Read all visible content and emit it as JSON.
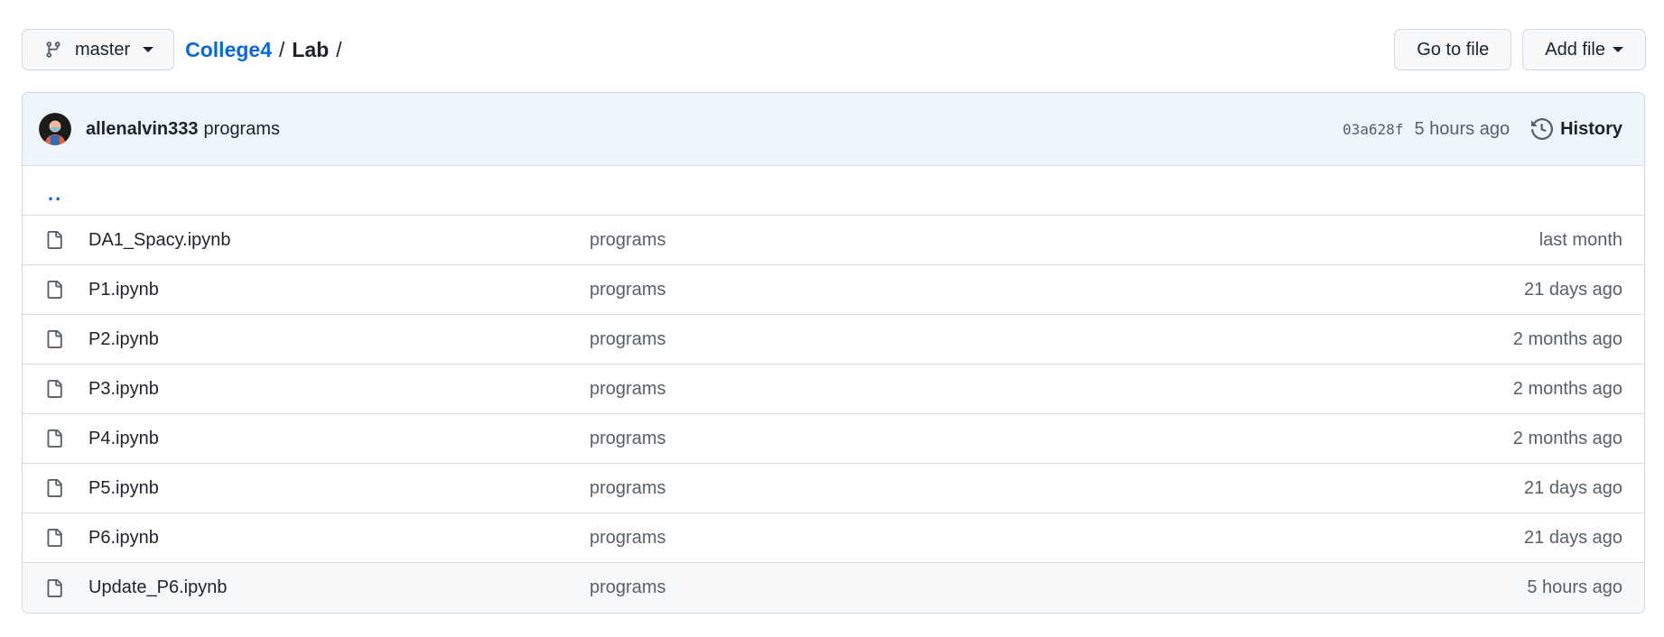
{
  "header": {
    "branch": "master",
    "breadcrumb": {
      "repo": "College4",
      "sep1": "/",
      "folder": "Lab",
      "sep2": "/"
    },
    "go_to_file": "Go to file",
    "add_file": "Add file"
  },
  "commit": {
    "author": "allenalvin333",
    "message": "programs",
    "sha": "03a628f",
    "time": "5 hours ago",
    "history": "History"
  },
  "parent_dir": "..",
  "files": [
    {
      "name": "DA1_Spacy.ipynb",
      "message": "programs",
      "time": "last month"
    },
    {
      "name": "P1.ipynb",
      "message": "programs",
      "time": "21 days ago"
    },
    {
      "name": "P2.ipynb",
      "message": "programs",
      "time": "2 months ago"
    },
    {
      "name": "P3.ipynb",
      "message": "programs",
      "time": "2 months ago"
    },
    {
      "name": "P4.ipynb",
      "message": "programs",
      "time": "2 months ago"
    },
    {
      "name": "P5.ipynb",
      "message": "programs",
      "time": "21 days ago"
    },
    {
      "name": "P6.ipynb",
      "message": "programs",
      "time": "21 days ago"
    },
    {
      "name": "Update_P6.ipynb",
      "message": "programs",
      "time": "5 hours ago"
    }
  ],
  "colors": {
    "link": "#0969da",
    "muted": "#57606a",
    "commit_bar_bg": "#eef5fd",
    "border": "#d0d7de"
  },
  "icons": {
    "branch": "git-branch-icon",
    "file": "file-icon",
    "history": "history-clock-icon",
    "caret": "caret-down-icon"
  }
}
